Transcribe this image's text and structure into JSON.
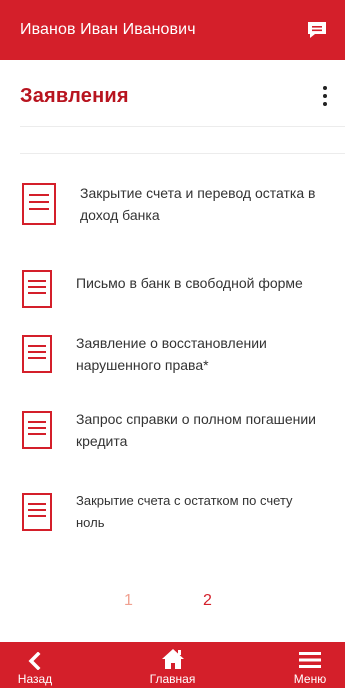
{
  "topbar": {
    "user_name": "Иванов Иван Иванович",
    "chat_icon": "chat-icon"
  },
  "header": {
    "title": "Заявления",
    "menu_icon": "more-vertical-icon"
  },
  "items": [
    {
      "label_line1": "Закрытие счета и перевод остатка в",
      "label_line2": "доход банка",
      "icon": "document-icon"
    },
    {
      "label_line1": "Письмо в банк в свободной форме",
      "label_line2": "",
      "icon": "document-icon"
    },
    {
      "label_line1": "Заявление о восстановлении",
      "label_line2": "нарушенного права*",
      "icon": "document-icon"
    },
    {
      "label_line1": "Запрос справки о полном погашении",
      "label_line2": "кредита",
      "icon": "document-icon"
    },
    {
      "label_line1": "Закрытие счета с остатком по счету",
      "label_line2": "ноль",
      "icon": "document-icon"
    }
  ],
  "pagination": {
    "page1": "1",
    "page2": "2",
    "current": 2
  },
  "bottom_nav": {
    "back": {
      "label": "Назад",
      "icon": "chevron-left-icon"
    },
    "home": {
      "label": "Главная",
      "icon": "home-icon"
    },
    "menu": {
      "label": "Меню",
      "icon": "hamburger-menu-icon"
    }
  },
  "colors": {
    "brand_red": "#d41f2a",
    "title_red": "#b8141f",
    "inactive_page": "#f0a090"
  }
}
